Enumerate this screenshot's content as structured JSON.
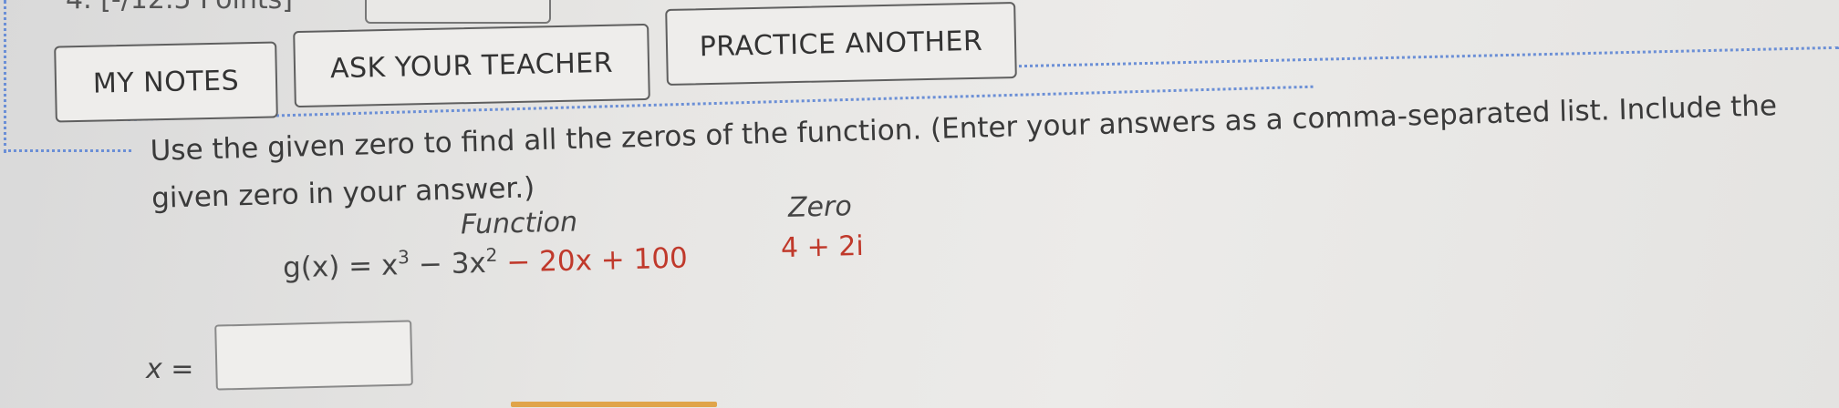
{
  "question": {
    "header_text": "4.  [-/12.5 Points]"
  },
  "toolbar": {
    "my_notes_label": "MY NOTES",
    "ask_teacher_label": "ASK YOUR TEACHER",
    "practice_another_label": "PRACTICE ANOTHER"
  },
  "problem": {
    "instructions": "Use the given zero to find all the zeros of the function. (Enter your answers as a comma-separated list. Include the given zero in your answer.)",
    "function_header": "Function",
    "zero_header": "Zero",
    "function_lhs": "g(x) = x",
    "exp1": "3",
    "term2": " − 3x",
    "exp2": "2",
    "term3": " − 20x + 100",
    "zero_value": "4 + 2i"
  },
  "answer": {
    "label": "x =",
    "value": ""
  },
  "colors": {
    "accent_red": "#c0392b",
    "dotted_blue": "#6b8fd6"
  }
}
